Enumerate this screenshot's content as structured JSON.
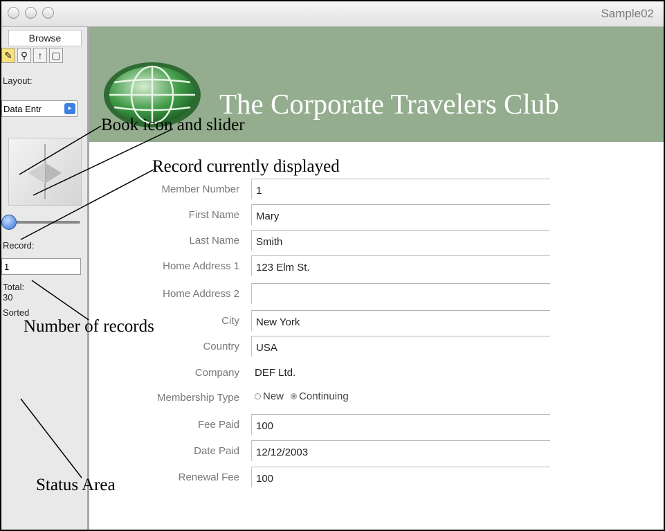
{
  "window": {
    "title": "Sample02"
  },
  "status_area": {
    "mode_tab": "Browse",
    "tools": [
      "browse-tool-icon",
      "find-tool-icon",
      "layout-tool-icon",
      "preview-tool-icon"
    ],
    "layout_label": "Layout:",
    "layout_value": "Data Entr",
    "record_label": "Record:",
    "record_value": "1",
    "total_label": "Total:",
    "total_value": "30",
    "sorted_label": "Sorted"
  },
  "banner": {
    "title": "The Corporate Travelers Club",
    "logo": "globe-logo-icon",
    "color": "#93ad8e"
  },
  "form": {
    "member_number": {
      "label": "Member Number",
      "value": "1"
    },
    "first_name": {
      "label": "First Name",
      "value": "Mary"
    },
    "last_name": {
      "label": "Last Name",
      "value": "Smith"
    },
    "home_address_1": {
      "label": "Home Address 1",
      "value": "123 Elm St."
    },
    "home_address_2": {
      "label": "Home Address 2",
      "value": ""
    },
    "city": {
      "label": "City",
      "value": "New York"
    },
    "country": {
      "label": "Country",
      "value": "USA"
    },
    "company": {
      "label": "Company",
      "value": "DEF Ltd."
    },
    "membership_type": {
      "label": "Membership Type",
      "options": [
        "New",
        "Continuing"
      ],
      "selected": "Continuing"
    },
    "fee_paid": {
      "label": "Fee Paid",
      "value": "100"
    },
    "date_paid": {
      "label": "Date Paid",
      "value": "12/12/2003"
    },
    "renewal_fee": {
      "label": "Renewal Fee",
      "value": "100"
    }
  },
  "annotations": {
    "book_icon": "Book icon and slider",
    "record_displayed": "Record currently displayed",
    "number_of_records": "Number of records",
    "status_area": "Status Area"
  }
}
